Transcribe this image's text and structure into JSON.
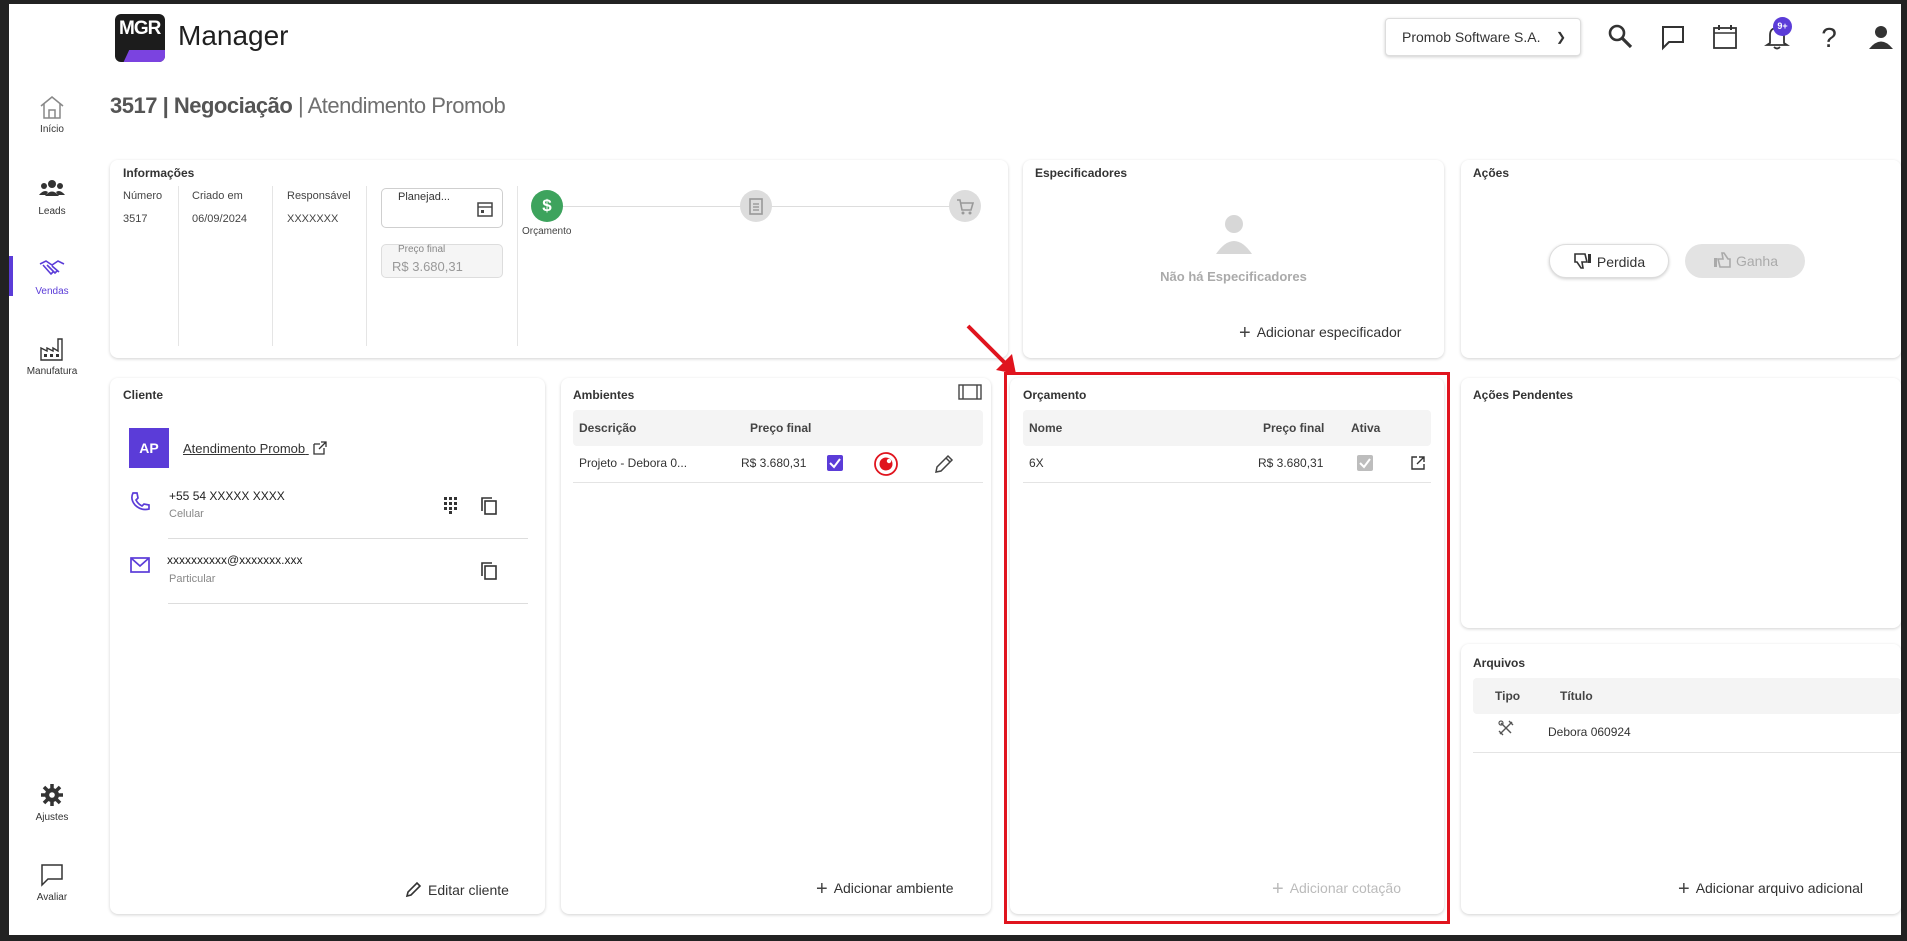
{
  "app": {
    "logo_text": "MGR",
    "name": "Manager",
    "company": "Promob Software S.A.",
    "notifications_badge": "9+"
  },
  "sidebar": {
    "items": [
      {
        "label": "Início",
        "icon": "home-icon"
      },
      {
        "label": "Leads",
        "icon": "people-icon"
      },
      {
        "label": "Vendas",
        "icon": "handshake-icon",
        "active": true
      },
      {
        "label": "Manufatura",
        "icon": "factory-icon"
      },
      {
        "label": "Ajustes",
        "icon": "gear-icon"
      },
      {
        "label": "Avaliar",
        "icon": "chat-icon"
      }
    ]
  },
  "header": {
    "id": "3517",
    "section": "Negociação",
    "subtitle": "Atendimento Promob"
  },
  "info": {
    "title": "Informações",
    "numero_label": "Número",
    "numero": "3517",
    "criado_label": "Criado em",
    "criado": "06/09/2024",
    "responsavel_label": "Responsável",
    "responsavel": "XXXXXXX",
    "planejado": "Planejad...",
    "preco_final_label": "Preço final",
    "preco_final": "R$ 3.680,31",
    "step_label": "Orçamento"
  },
  "especificadores": {
    "title": "Especificadores",
    "empty": "Não há Especificadores",
    "add": "Adicionar especificador"
  },
  "acoes": {
    "title": "Ações",
    "perdida": "Perdida",
    "ganha": "Ganha"
  },
  "cliente": {
    "title": "Cliente",
    "initials": "AP",
    "name": "Atendimento Promob",
    "phone": "+55 54 XXXXX XXXX",
    "phone_type": "Celular",
    "email": "xxxxxxxxxx@xxxxxxx.xxx",
    "email_type": "Particular",
    "edit": "Editar cliente"
  },
  "ambientes": {
    "title": "Ambientes",
    "col_desc": "Descrição",
    "col_preco": "Preço final",
    "rows": [
      {
        "desc": "Projeto - Debora 0...",
        "preco": "R$ 3.680,31"
      }
    ],
    "add": "Adicionar ambiente"
  },
  "orcamento": {
    "title": "Orçamento",
    "col_nome": "Nome",
    "col_preco": "Preço final",
    "col_ativa": "Ativa",
    "rows": [
      {
        "nome": "6X",
        "preco": "R$ 3.680,31"
      }
    ],
    "add": "Adicionar cotação"
  },
  "pendentes": {
    "title": "Ações Pendentes"
  },
  "arquivos": {
    "title": "Arquivos",
    "col_tipo": "Tipo",
    "col_titulo": "Título",
    "rows": [
      {
        "titulo": "Debora 060924"
      }
    ],
    "add": "Adicionar arquivo adicional"
  }
}
